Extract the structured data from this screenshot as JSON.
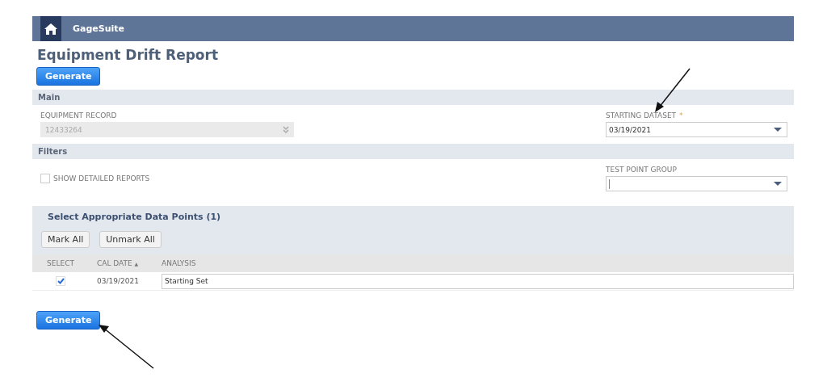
{
  "header": {
    "app_name": "GageSuite"
  },
  "page_title": "Equipment Drift Report",
  "top_button": "Generate",
  "main_section": {
    "title": "Main",
    "equipment_record": {
      "label": "EQUIPMENT RECORD",
      "value": "12433264",
      "disabled": true
    },
    "starting_dataset": {
      "label": "STARTING DATASET",
      "required_mark": "*",
      "value": "03/19/2021"
    }
  },
  "filters_section": {
    "title": "Filters",
    "show_detailed_reports": {
      "label": "SHOW DETAILED REPORTS",
      "checked": false
    },
    "test_point_group": {
      "label": "TEST POINT GROUP"
    }
  },
  "data_points": {
    "title": "Select Appropriate Data Points (1)",
    "buttons": [
      "Mark All",
      "Unmark All"
    ],
    "columns": [
      {
        "label": "SELECT"
      },
      {
        "label": "CAL DATE",
        "sort_mark": "▲"
      },
      {
        "label": "ANALYSIS"
      }
    ],
    "rows": [
      {
        "checked": true,
        "cal_date": "03/19/2021",
        "analysis": "Starting Set"
      }
    ]
  },
  "bottom_button": "Generate"
}
